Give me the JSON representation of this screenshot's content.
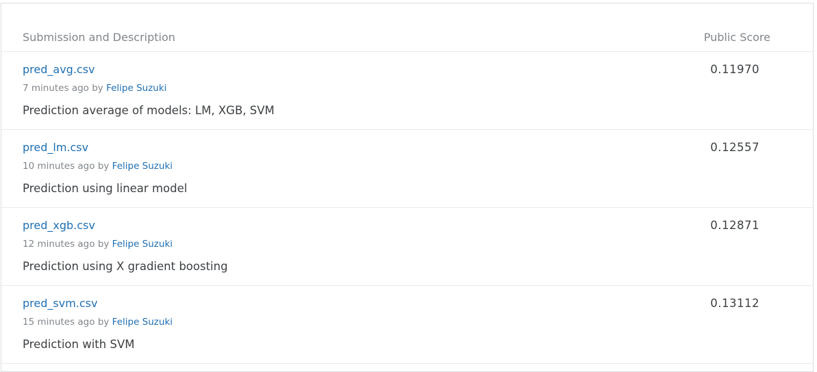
{
  "table": {
    "header": {
      "description": "Submission and Description",
      "score": "Public Score"
    },
    "rows": [
      {
        "file": "pred_avg.csv",
        "time": "7 minutes ago",
        "by": "by",
        "author": "Felipe Suzuki",
        "description": "Prediction average of models: LM, XGB, SVM",
        "score": "0.11970"
      },
      {
        "file": "pred_lm.csv",
        "time": "10 minutes ago",
        "by": "by",
        "author": "Felipe Suzuki",
        "description": "Prediction using linear model",
        "score": "0.12557"
      },
      {
        "file": "pred_xgb.csv",
        "time": "12 minutes ago",
        "by": "by",
        "author": "Felipe Suzuki",
        "description": "Prediction using X gradient boosting",
        "score": "0.12871"
      },
      {
        "file": "pred_svm.csv",
        "time": "15 minutes ago",
        "by": "by",
        "author": "Felipe Suzuki",
        "description": "Prediction with SVM",
        "score": "0.13112"
      }
    ]
  }
}
